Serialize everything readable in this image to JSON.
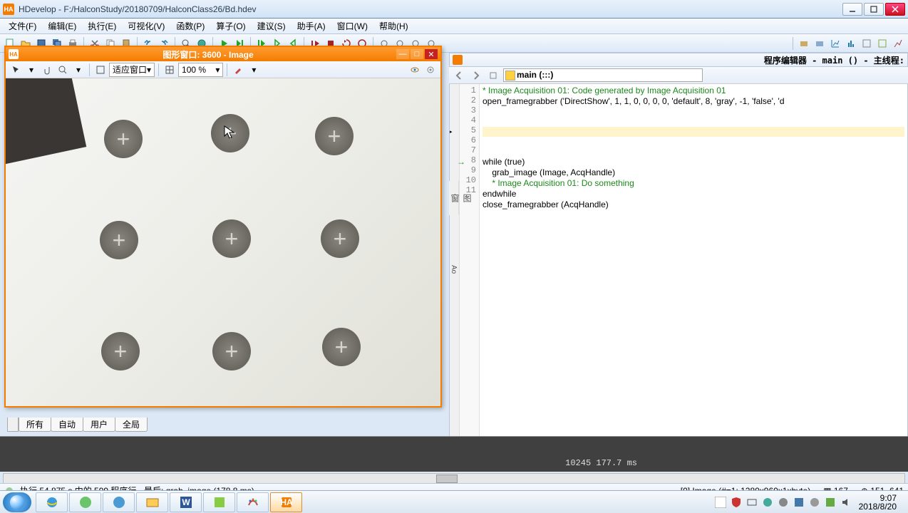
{
  "window": {
    "title": "HDevelop - F:/HalconStudy/20180709/HalconClass26/Bd.hdev"
  },
  "menu": {
    "file": "文件(F)",
    "edit": "编辑(E)",
    "run": "执行(E)",
    "visualize": "可视化(V)",
    "func": "函数(P)",
    "operator": "算子(O)",
    "suggest": "建议(S)",
    "assist": "助手(A)",
    "win": "窗口(W)",
    "help": "帮助(H)"
  },
  "gwin": {
    "title": "图形窗口: 3600 - Image",
    "fit": "适应窗口",
    "zoom": "100 %"
  },
  "tabs": {
    "all": "所有",
    "auto": "自动",
    "user": "用户",
    "global": "全局"
  },
  "editor": {
    "title": "程序编辑器 - main () - 主线程:",
    "func": "main (:::)",
    "sidecol1": "Ao",
    "sidecol2": "窗",
    "sidecol3": "图",
    "lines": {
      "l1": "* Image Acquisition 01: Code generated by Image Acquisition 01",
      "l2": "open_framegrabber ('DirectShow', 1, 1, 0, 0, 0, 0, 'default', 8, 'gray', -1, 'false', 'd",
      "l7": "while (true)",
      "l8": "    grab_image (Image, AcqHandle)",
      "l9": "    * Image Acquisition 01: Do something",
      "l10": "endwhile",
      "l11": "close_framegrabber (AcqHandle)"
    }
  },
  "bottom": {
    "info": "10245  177.7 ms"
  },
  "status": {
    "exec": "执行 54.875 s 中的 599 程序行 - 最后: grab_image (178.8 ms)",
    "image": "[0] Image (#=1: 1280x960x1xbyte)",
    "mem": "167",
    "coord": "151, 641"
  },
  "tray": {
    "time": "9:07",
    "date": "2018/8/20"
  },
  "chart_data": null
}
